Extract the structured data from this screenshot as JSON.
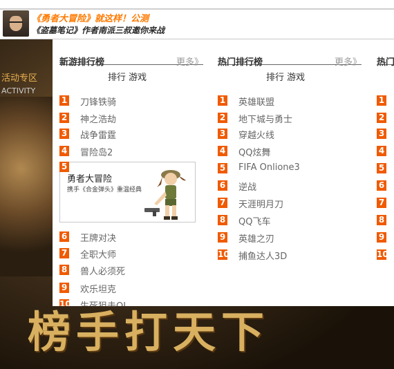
{
  "banner": {
    "line1": "《勇者大冒险》就这样！公测",
    "line2": "《盗墓笔记》作者南派三叔邀你来战"
  },
  "sidebar": {
    "zone_label": "活动专区",
    "activity_label": "ACTIVITY"
  },
  "background": {
    "calligraphy": "榜手打天下"
  },
  "columns": [
    {
      "title": "新游排行榜",
      "more": "更多》",
      "subheader": "排行 游戏",
      "items": [
        {
          "rank": "1",
          "name": "刀锋铁骑"
        },
        {
          "rank": "2",
          "name": "神之浩劫"
        },
        {
          "rank": "3",
          "name": "战争雷霆"
        },
        {
          "rank": "4",
          "name": "冒险岛2"
        },
        {
          "rank": "6",
          "name": "王牌对决"
        },
        {
          "rank": "7",
          "name": "全职大师"
        },
        {
          "rank": "8",
          "name": "兽人必须死"
        },
        {
          "rank": "9",
          "name": "欢乐坦克"
        },
        {
          "rank": "10",
          "name": "生死狙击OL"
        }
      ],
      "featured": {
        "rank": "5",
        "title": "勇者大冒险",
        "desc": "携手《合金弹头》重温经典"
      }
    },
    {
      "title": "热门排行榜",
      "more": "更多》",
      "subheader": "排行 游戏",
      "items": [
        {
          "rank": "1",
          "name": "英雄联盟"
        },
        {
          "rank": "2",
          "name": "地下城与勇士"
        },
        {
          "rank": "3",
          "name": "穿越火线"
        },
        {
          "rank": "4",
          "name": "QQ炫舞"
        },
        {
          "rank": "5",
          "name": "FIFA Onlione3"
        },
        {
          "rank": "6",
          "name": "逆战"
        },
        {
          "rank": "7",
          "name": "天涯明月刀"
        },
        {
          "rank": "8",
          "name": "QQ飞车"
        },
        {
          "rank": "9",
          "name": "英雄之刃"
        },
        {
          "rank": "10",
          "name": "捕鱼达人3D"
        }
      ]
    },
    {
      "title": "热门",
      "items": [
        {
          "rank": "1"
        },
        {
          "rank": "2"
        },
        {
          "rank": "3"
        },
        {
          "rank": "4"
        },
        {
          "rank": "5"
        },
        {
          "rank": "6"
        },
        {
          "rank": "7"
        },
        {
          "rank": "8"
        },
        {
          "rank": "9"
        },
        {
          "rank": "10"
        }
      ]
    }
  ]
}
